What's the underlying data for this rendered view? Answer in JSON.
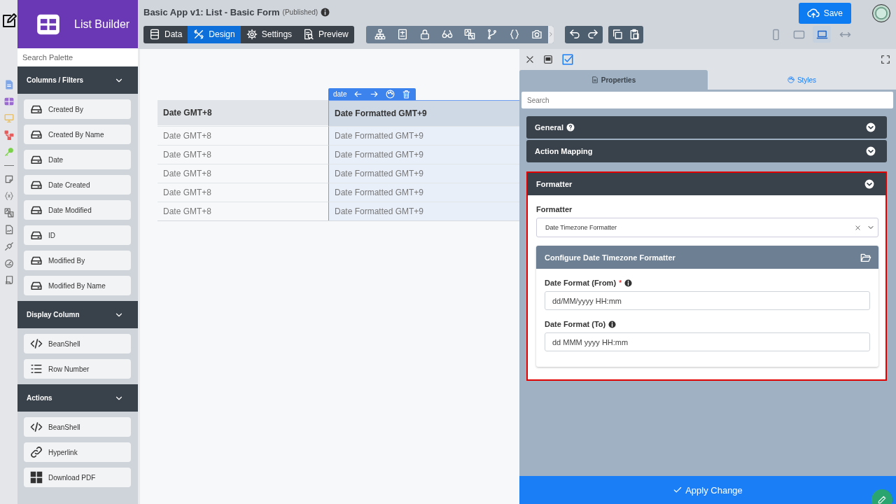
{
  "app": {
    "title": "Basic App v1: List - Basic Form",
    "status": "(Published)"
  },
  "builder": {
    "title": "List Builder"
  },
  "palette": {
    "search_placeholder": "Search Palette",
    "sections": [
      {
        "title": "Columns / Filters",
        "expanded": true,
        "items": [
          {
            "label": "Created By",
            "kind": "field"
          },
          {
            "label": "Created By Name",
            "kind": "field"
          },
          {
            "label": "Date",
            "kind": "field"
          },
          {
            "label": "Date Created",
            "kind": "field"
          },
          {
            "label": "Date Modified",
            "kind": "field"
          },
          {
            "label": "ID",
            "kind": "field"
          },
          {
            "label": "Modified By",
            "kind": "field"
          },
          {
            "label": "Modified By Name",
            "kind": "field"
          }
        ]
      },
      {
        "title": "Display Column",
        "expanded": true,
        "items": [
          {
            "label": "BeanShell",
            "kind": "code"
          },
          {
            "label": "Row Number",
            "kind": "list"
          }
        ]
      },
      {
        "title": "Actions",
        "expanded": true,
        "items": [
          {
            "label": "BeanShell",
            "kind": "code"
          },
          {
            "label": "Hyperlink",
            "kind": "link"
          },
          {
            "label": "Download PDF",
            "kind": "pdf"
          }
        ]
      }
    ]
  },
  "mode_tabs": [
    {
      "label": "Data",
      "kind": "data",
      "selected": false
    },
    {
      "label": "Design",
      "kind": "design",
      "selected": true
    },
    {
      "label": "Settings",
      "kind": "settings",
      "selected": false
    },
    {
      "label": "Preview",
      "kind": "preview",
      "selected": false
    }
  ],
  "devices": [
    {
      "kind": "phone",
      "selected": false
    },
    {
      "kind": "tablet",
      "selected": false
    },
    {
      "kind": "laptop",
      "selected": true
    },
    {
      "kind": "full",
      "selected": false
    }
  ],
  "save_button": "Save",
  "column_toolbar": {
    "label": "date"
  },
  "table": {
    "columns": [
      {
        "label": "Date GMT+8",
        "selected": false
      },
      {
        "label": "Date Formatted GMT+9",
        "selected": true
      }
    ],
    "rows": [
      [
        "Date GMT+8",
        "Date Formatted GMT+9"
      ],
      [
        "Date GMT+8",
        "Date Formatted GMT+9"
      ],
      [
        "Date GMT+8",
        "Date Formatted GMT+9"
      ],
      [
        "Date GMT+8",
        "Date Formatted GMT+9"
      ],
      [
        "Date GMT+8",
        "Date Formatted GMT+9"
      ]
    ]
  },
  "properties": {
    "tabs": [
      {
        "label": "Properties",
        "kind": "properties",
        "selected": true
      },
      {
        "label": "Styles",
        "kind": "styles",
        "selected": false
      }
    ],
    "search_placeholder": "Search",
    "sections": [
      {
        "title": "General",
        "help": true,
        "expanded": false,
        "highlighted": false
      },
      {
        "title": "Action Mapping",
        "help": false,
        "expanded": false,
        "highlighted": false
      },
      {
        "title": "Formatter",
        "help": false,
        "expanded": true,
        "highlighted": true
      }
    ],
    "formatter": {
      "label": "Formatter",
      "value": "Date Timezone Formatter",
      "config_title": "Configure Date Timezone Formatter",
      "fields": [
        {
          "label": "Date Format (From)",
          "required_mark": "*",
          "value": "dd/MM/yyyy HH:mm"
        },
        {
          "label": "Date Format (To)",
          "value": "dd MMM yyyy HH:mm"
        }
      ]
    },
    "apply_button": "Apply Change"
  }
}
